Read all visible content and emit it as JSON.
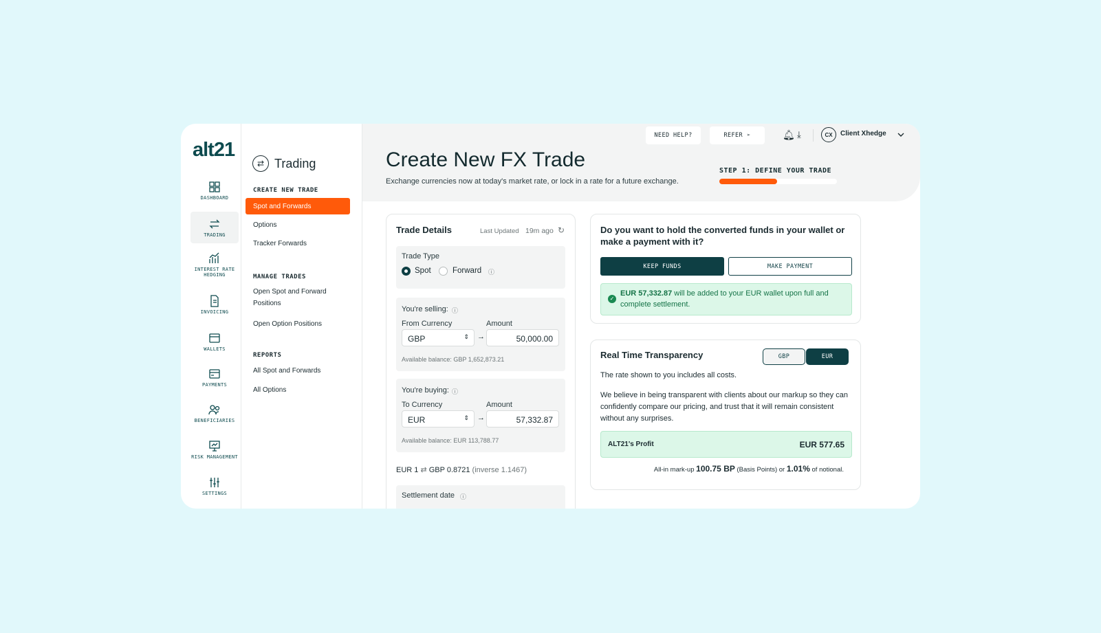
{
  "brand": {
    "logo": "alt21"
  },
  "rail": [
    {
      "label": "DASHBOARD",
      "icon": "dashboard-icon"
    },
    {
      "label": "TRADING",
      "icon": "trading-icon"
    },
    {
      "label": "INTEREST RATE HEDGING",
      "icon": "chart-icon"
    },
    {
      "label": "INVOICING",
      "icon": "invoice-icon"
    },
    {
      "label": "WALLETS",
      "icon": "wallet-icon"
    },
    {
      "label": "PAYMENTS",
      "icon": "card-icon"
    },
    {
      "label": "BENEFICIARIES",
      "icon": "people-icon"
    },
    {
      "label": "RISK MANAGEMENT",
      "icon": "presentation-icon"
    },
    {
      "label": "SETTINGS",
      "icon": "sliders-icon"
    }
  ],
  "submenu": {
    "title": "Trading",
    "sections": [
      {
        "heading": "CREATE NEW TRADE",
        "items": [
          "Spot and Forwards",
          "Options",
          "Tracker Forwards"
        ]
      },
      {
        "heading": "MANAGE TRADES",
        "items": [
          "Open Spot and Forward Positions",
          "Open Option Positions"
        ]
      },
      {
        "heading": "REPORTS",
        "items": [
          "All Spot and Forwards",
          "All Options"
        ]
      }
    ]
  },
  "topbar": {
    "help": "NEED HELP?",
    "refer": "REFER",
    "user_initials": "CX",
    "user_name": "Client Xhedge"
  },
  "page": {
    "title": "Create New FX Trade",
    "subtitle": "Exchange currencies now at today's market rate, or lock in a rate for a future exchange.",
    "step": "STEP 1: DEFINE YOUR TRADE",
    "progress": 0.49
  },
  "trade": {
    "heading": "Trade Details",
    "last_updated_label": "Last Updated",
    "last_updated": "19m ago",
    "type_label": "Trade Type",
    "spot": "Spot",
    "forward": "Forward",
    "selling_label": "You're selling:",
    "from_label": "From Currency",
    "amount_label": "Amount",
    "from_currency": "GBP",
    "sell_amount": "50,000.00",
    "sell_balance": "Available balance: GBP 1,652,873.21",
    "buying_label": "You're buying:",
    "to_label": "To Currency",
    "to_currency": "EUR",
    "buy_amount": "57,332.87",
    "buy_balance": "Available balance: EUR 113,788.77",
    "rate_base": "EUR 1",
    "rate_quote": "GBP 0.8721",
    "rate_inverse": "(inverse 1.1467)",
    "settlement_label": "Settlement date"
  },
  "funds": {
    "question": "Do you want to hold the converted funds in your wallet or make a payment with it?",
    "keep": "KEEP FUNDS",
    "pay": "MAKE PAYMENT",
    "note_amount": "EUR 57,332.87",
    "note_rest": " will be added to your EUR wallet upon full and complete settlement."
  },
  "transparency": {
    "heading": "Real Time Transparency",
    "toggle_gbp": "GBP",
    "toggle_eur": "EUR",
    "line1": "The rate shown to you includes all costs.",
    "line2": "We believe in being transparent with clients about our markup so they can confidently compare our pricing, and trust that it will remain consistent without any surprises.",
    "profit_label": "ALT21's Profit",
    "profit_value": "EUR 577.65",
    "markup_prefix": "All-in mark-up",
    "markup_bp": "100.75 BP",
    "markup_mid": "(Basis Points) or",
    "markup_pct": "1.01%",
    "markup_suffix": "of notional."
  },
  "colors": {
    "accent": "#ff5a0a",
    "primary": "#0e3f44",
    "success": "#dcf7e8"
  }
}
